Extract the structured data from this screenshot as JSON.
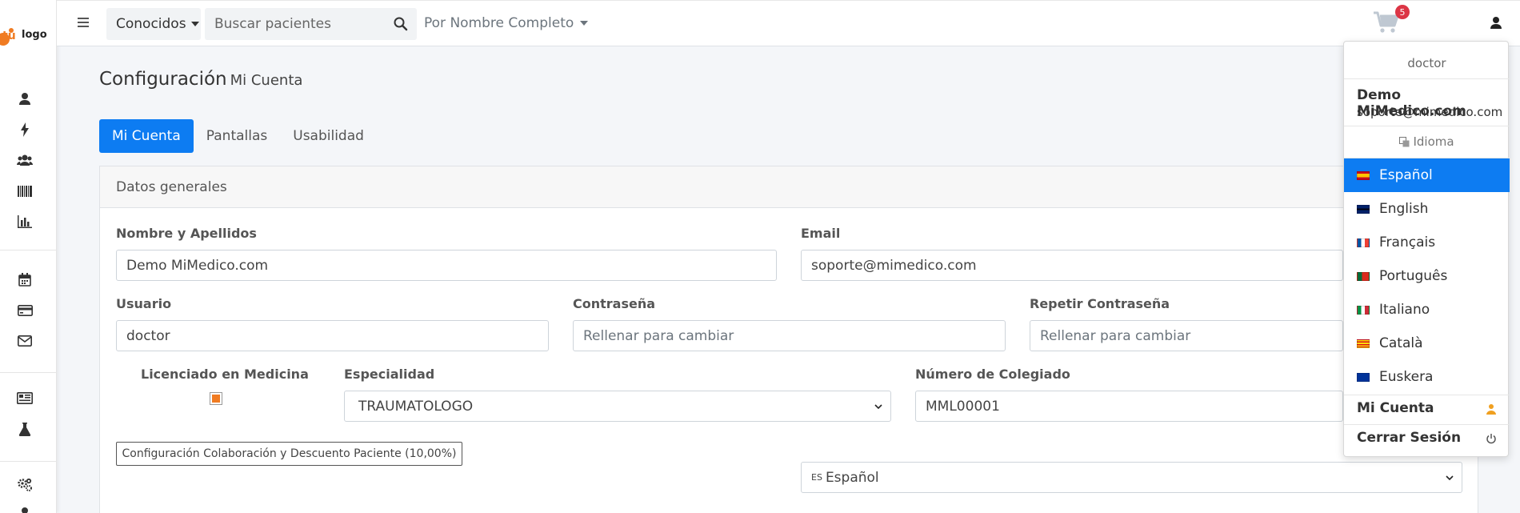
{
  "logo": {
    "text": "tu logo"
  },
  "sidebar": {
    "items": [
      {
        "icon": "user-icon"
      },
      {
        "icon": "bolt-icon"
      },
      {
        "icon": "users-icon"
      },
      {
        "icon": "barcode-icon"
      },
      {
        "icon": "bar-chart-icon"
      },
      {
        "icon": "calendar-icon"
      },
      {
        "icon": "credit-card-icon"
      },
      {
        "icon": "envelope-icon"
      },
      {
        "icon": "newspaper-icon"
      },
      {
        "icon": "flask-icon"
      },
      {
        "icon": "cogs-icon"
      }
    ]
  },
  "topbar": {
    "known_label": "Conocidos",
    "search_placeholder": "Buscar pacientes",
    "search_by_label": "Por Nombre Completo",
    "cart_count": "5"
  },
  "page": {
    "title": "Configuración",
    "subtitle": "Mi Cuenta"
  },
  "tabs": [
    {
      "label": "Mi Cuenta",
      "active": true
    },
    {
      "label": "Pantallas",
      "active": false
    },
    {
      "label": "Usabilidad",
      "active": false
    }
  ],
  "card": {
    "header": "Datos generales"
  },
  "form": {
    "name_label": "Nombre y Apellidos",
    "name_value": "Demo MiMedico.com",
    "email_label": "Email",
    "email_value": "soporte@mimedico.com",
    "user_label": "Usuario",
    "user_value": "doctor",
    "password_label": "Contraseña",
    "password_placeholder": "Rellenar para cambiar",
    "password_repeat_label": "Repetir Contraseña",
    "password_repeat_placeholder": "Rellenar para cambiar",
    "licensed_label": "Licenciado en Medicina",
    "specialty_label": "Especialidad",
    "specialty_value": "TRAUMATOLOGO",
    "collegiate_label": "Número de Colegiado",
    "collegiate_value": "MML00001",
    "collab_button": "Configuración Colaboración y Descuento Paciente (10,00%)",
    "language_code": "ES",
    "language_value": "Español"
  },
  "user_menu": {
    "role": "doctor",
    "name": "Demo MiMedico.com",
    "email": "soporte@mimedico.com",
    "language_header": "Idioma",
    "languages": [
      {
        "label": "Español",
        "active": true
      },
      {
        "label": "English",
        "active": false
      },
      {
        "label": "Français",
        "active": false
      },
      {
        "label": "Português",
        "active": false
      },
      {
        "label": "Italiano",
        "active": false
      },
      {
        "label": "Català",
        "active": false
      },
      {
        "label": "Euskera",
        "active": false
      }
    ],
    "account_label": "Mi Cuenta",
    "logout_label": "Cerrar Sesión"
  },
  "colors": {
    "primary": "#0d7cf2",
    "badge": "#dc3545",
    "checkbox_fill": "#f07b22",
    "logo_orange": "#f07b22"
  }
}
